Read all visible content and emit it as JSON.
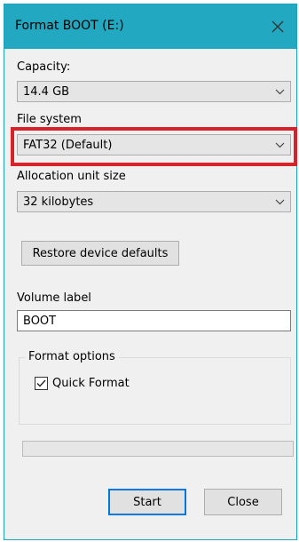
{
  "window": {
    "title": "Format BOOT (E:)",
    "close_icon": "close-icon"
  },
  "capacity": {
    "label": "Capacity:",
    "value": "14.4 GB"
  },
  "file_system": {
    "label": "File system",
    "value": "FAT32 (Default)",
    "highlight_color": "#d7222a"
  },
  "allocation": {
    "label": "Allocation unit size",
    "value": "32 kilobytes"
  },
  "restore_button": {
    "label": "Restore device defaults"
  },
  "volume_label": {
    "label": "Volume label",
    "value": "BOOT"
  },
  "format_options": {
    "title": "Format options",
    "quick_format": {
      "label": "Quick Format",
      "checked": true
    }
  },
  "progress": {
    "value": 0
  },
  "buttons": {
    "start": "Start",
    "close": "Close"
  },
  "colors": {
    "titlebar": "#22a8c0",
    "accent": "#0078d7"
  }
}
